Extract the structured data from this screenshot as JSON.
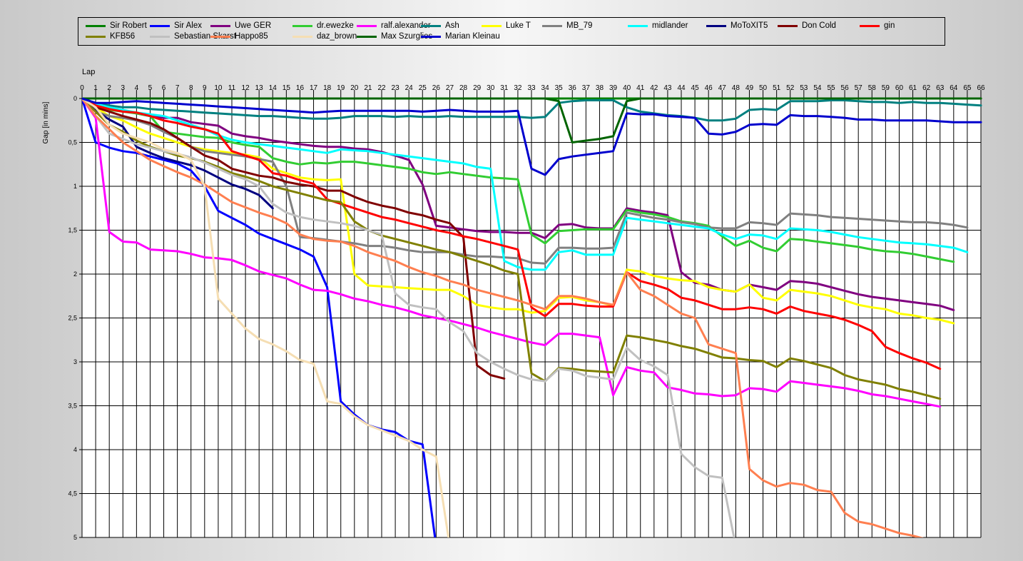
{
  "chart_data": {
    "type": "line",
    "xlabel": "Lap",
    "ylabel": "Gap [in mins]",
    "xlim": [
      0,
      66
    ],
    "ylim": [
      0,
      5
    ],
    "y_ticks": [
      0,
      0.5,
      1,
      1.5,
      2,
      2.5,
      3,
      3.5,
      4,
      4.5,
      5
    ],
    "y_tick_labels": [
      "0",
      "0,5",
      "1",
      "1,5",
      "2",
      "2,5",
      "3",
      "3,5",
      "4",
      "4,5",
      "5"
    ],
    "y_inverted": true,
    "grid": true,
    "legend": "top",
    "series": [
      {
        "name": "Sir Robert",
        "color": "#008000",
        "values": [
          0,
          0,
          0,
          0,
          0,
          0,
          0,
          0,
          0,
          0,
          0,
          0,
          0,
          0,
          0,
          0,
          0,
          0,
          0,
          0,
          0,
          0,
          0,
          0,
          0,
          0,
          0,
          0,
          0,
          0,
          0,
          0,
          0,
          0,
          0,
          0,
          0,
          0,
          0,
          0,
          0,
          0,
          0,
          0,
          0,
          0,
          0,
          0,
          0,
          0,
          0,
          0,
          0,
          0,
          0,
          0,
          0,
          0,
          0,
          0,
          0,
          0,
          0,
          0,
          0,
          0,
          0
        ]
      },
      {
        "name": "Sir Alex",
        "color": "#0000ff",
        "values": [
          0,
          0.5,
          0.56,
          0.6,
          0.62,
          0.66,
          0.7,
          0.74,
          0.82,
          1.0,
          1.28,
          1.36,
          1.44,
          1.54,
          1.6,
          1.66,
          1.72,
          1.8,
          2.15,
          3.45,
          3.6,
          3.72,
          3.77,
          3.8,
          3.9,
          3.94,
          5.1
        ]
      },
      {
        "name": "Uwe GER",
        "color": "#800080",
        "values": [
          0,
          0.1,
          0.12,
          0.14,
          0.17,
          0.2,
          0.22,
          0.22,
          0.27,
          0.29,
          0.31,
          0.4,
          0.43,
          0.45,
          0.48,
          0.5,
          0.52,
          0.54,
          0.55,
          0.55,
          0.57,
          0.58,
          0.61,
          0.65,
          0.7,
          0.98,
          1.45,
          1.47,
          1.49,
          1.51,
          1.52,
          1.52,
          1.53,
          1.53,
          1.59,
          1.44,
          1.43,
          1.47,
          1.48,
          1.48,
          1.25,
          1.28,
          1.3,
          1.33,
          1.98,
          2.1,
          2.12,
          2.18,
          2.2,
          2.12,
          2.15,
          2.18,
          2.08,
          2.09,
          2.11,
          2.15,
          2.19,
          2.23,
          2.26,
          2.28,
          2.3,
          2.32,
          2.34,
          2.36,
          2.41
        ]
      },
      {
        "name": "dr.ewezke",
        "color": "#32cd32",
        "values": [
          0,
          0.1,
          0.13,
          0.15,
          0.17,
          0.2,
          0.38,
          0.4,
          0.42,
          0.44,
          0.45,
          0.5,
          0.53,
          0.55,
          0.68,
          0.72,
          0.75,
          0.73,
          0.74,
          0.72,
          0.72,
          0.74,
          0.76,
          0.78,
          0.8,
          0.84,
          0.86,
          0.84,
          0.86,
          0.88,
          0.9,
          0.91,
          0.92,
          1.55,
          1.65,
          1.51,
          1.5,
          1.49,
          1.49,
          1.49,
          1.27,
          1.3,
          1.32,
          1.35,
          1.4,
          1.42,
          1.45,
          1.57,
          1.68,
          1.62,
          1.7,
          1.74,
          1.6,
          1.61,
          1.63,
          1.65,
          1.67,
          1.69,
          1.72,
          1.74,
          1.75,
          1.77,
          1.8,
          1.83,
          1.86
        ]
      },
      {
        "name": "ralf.alexander",
        "color": "#ff00ff",
        "values": [
          0,
          0.22,
          1.52,
          1.63,
          1.64,
          1.72,
          1.73,
          1.74,
          1.77,
          1.81,
          1.82,
          1.84,
          1.9,
          1.97,
          2.01,
          2.05,
          2.12,
          2.18,
          2.19,
          2.23,
          2.28,
          2.31,
          2.35,
          2.38,
          2.42,
          2.47,
          2.5,
          2.53,
          2.57,
          2.61,
          2.66,
          2.7,
          2.74,
          2.78,
          2.81,
          2.68,
          2.68,
          2.7,
          2.72,
          3.38,
          3.06,
          3.1,
          3.12,
          3.29,
          3.32,
          3.36,
          3.37,
          3.39,
          3.38,
          3.3,
          3.31,
          3.34,
          3.22,
          3.24,
          3.26,
          3.28,
          3.3,
          3.33,
          3.37,
          3.39,
          3.42,
          3.45,
          3.48,
          3.51
        ]
      },
      {
        "name": "Ash",
        "color": "#008080",
        "values": [
          0,
          0.05,
          0.08,
          0.1,
          0.1,
          0.12,
          0.13,
          0.14,
          0.15,
          0.16,
          0.17,
          0.18,
          0.19,
          0.2,
          0.2,
          0.21,
          0.22,
          0.23,
          0.23,
          0.22,
          0.2,
          0.2,
          0.2,
          0.21,
          0.2,
          0.21,
          0.21,
          0.2,
          0.21,
          0.21,
          0.21,
          0.21,
          0.21,
          0.22,
          0.21,
          0.05,
          0.03,
          0.02,
          0.02,
          0.02,
          0.1,
          0.15,
          0.17,
          0.19,
          0.2,
          0.22,
          0.25,
          0.25,
          0.23,
          0.13,
          0.12,
          0.13,
          0.03,
          0.03,
          0.03,
          0.02,
          0.02,
          0.03,
          0.04,
          0.04,
          0.05,
          0.04,
          0.05,
          0.05,
          0.06,
          0.07,
          0.08
        ]
      },
      {
        "name": "Luke T",
        "color": "#ffff00",
        "values": [
          0,
          0.1,
          0.2,
          0.25,
          0.33,
          0.4,
          0.45,
          0.5,
          0.55,
          0.58,
          0.6,
          0.62,
          0.64,
          0.67,
          0.8,
          0.85,
          0.9,
          0.92,
          0.93,
          0.92,
          2.0,
          2.13,
          2.14,
          2.15,
          2.16,
          2.17,
          2.18,
          2.18,
          2.25,
          2.35,
          2.38,
          2.4,
          2.4,
          2.44,
          2.42,
          2.27,
          2.26,
          2.3,
          2.32,
          2.36,
          1.95,
          1.97,
          2.02,
          2.05,
          2.07,
          2.08,
          2.15,
          2.18,
          2.2,
          2.12,
          2.27,
          2.3,
          2.18,
          2.2,
          2.22,
          2.25,
          2.3,
          2.35,
          2.38,
          2.4,
          2.45,
          2.47,
          2.5,
          2.52,
          2.56
        ]
      },
      {
        "name": "MB_79",
        "color": "#808080",
        "values": [
          0,
          0.15,
          0.2,
          0.22,
          0.25,
          0.3,
          0.38,
          0.45,
          0.55,
          0.6,
          0.62,
          0.64,
          0.66,
          0.69,
          0.72,
          1.0,
          1.58,
          1.59,
          1.61,
          1.63,
          1.65,
          1.68,
          1.68,
          1.7,
          1.73,
          1.75,
          1.75,
          1.75,
          1.78,
          1.8,
          1.8,
          1.81,
          1.82,
          1.87,
          1.88,
          1.7,
          1.7,
          1.71,
          1.71,
          1.7,
          1.3,
          1.33,
          1.36,
          1.38,
          1.41,
          1.43,
          1.47,
          1.48,
          1.48,
          1.41,
          1.42,
          1.44,
          1.31,
          1.32,
          1.33,
          1.35,
          1.36,
          1.37,
          1.38,
          1.39,
          1.4,
          1.41,
          1.41,
          1.42,
          1.44,
          1.47
        ]
      },
      {
        "name": "midlander",
        "color": "#00ffff",
        "values": [
          0,
          0.06,
          0.1,
          0.13,
          0.16,
          0.18,
          0.2,
          0.25,
          0.3,
          0.35,
          0.42,
          0.47,
          0.5,
          0.52,
          0.54,
          0.56,
          0.58,
          0.6,
          0.62,
          0.58,
          0.59,
          0.6,
          0.62,
          0.64,
          0.66,
          0.68,
          0.7,
          0.72,
          0.74,
          0.78,
          0.8,
          1.85,
          1.92,
          1.95,
          1.95,
          1.75,
          1.73,
          1.78,
          1.78,
          1.78,
          1.36,
          1.38,
          1.4,
          1.42,
          1.44,
          1.46,
          1.48,
          1.55,
          1.6,
          1.55,
          1.56,
          1.6,
          1.48,
          1.49,
          1.5,
          1.52,
          1.55,
          1.58,
          1.6,
          1.62,
          1.64,
          1.65,
          1.66,
          1.68,
          1.7,
          1.75
        ]
      },
      {
        "name": "MoToXIT5",
        "color": "#000080",
        "values": [
          0,
          0.14,
          0.24,
          0.32,
          0.55,
          0.62,
          0.68,
          0.72,
          0.76,
          0.82,
          0.9,
          0.98,
          1.03,
          1.1,
          1.25
        ]
      },
      {
        "name": "Don Cold",
        "color": "#800000",
        "values": [
          0,
          0.1,
          0.15,
          0.2,
          0.24,
          0.28,
          0.35,
          0.45,
          0.55,
          0.65,
          0.7,
          0.8,
          0.84,
          0.88,
          0.9,
          0.95,
          0.98,
          1.0,
          1.05,
          1.05,
          1.12,
          1.18,
          1.22,
          1.25,
          1.3,
          1.33,
          1.38,
          1.42,
          1.58,
          3.04,
          3.15,
          3.19
        ]
      },
      {
        "name": "gin",
        "color": "#ff0000",
        "values": [
          0,
          0.08,
          0.12,
          0.15,
          0.16,
          0.2,
          0.25,
          0.28,
          0.32,
          0.35,
          0.4,
          0.6,
          0.65,
          0.7,
          0.85,
          0.88,
          0.93,
          0.97,
          1.15,
          1.2,
          1.25,
          1.3,
          1.35,
          1.38,
          1.42,
          1.46,
          1.5,
          1.53,
          1.57,
          1.6,
          1.64,
          1.68,
          1.72,
          2.38,
          2.48,
          2.34,
          2.34,
          2.36,
          2.37,
          2.37,
          1.98,
          2.08,
          2.12,
          2.17,
          2.27,
          2.3,
          2.35,
          2.4,
          2.4,
          2.38,
          2.4,
          2.45,
          2.37,
          2.42,
          2.45,
          2.48,
          2.52,
          2.58,
          2.65,
          2.83,
          2.9,
          2.96,
          3.01,
          3.08
        ]
      },
      {
        "name": "KFB56",
        "color": "#808000",
        "values": [
          0,
          0.15,
          0.3,
          0.38,
          0.48,
          0.55,
          0.6,
          0.65,
          0.68,
          0.72,
          0.78,
          0.85,
          0.89,
          0.94,
          1.0,
          1.04,
          1.08,
          1.12,
          1.16,
          1.18,
          1.4,
          1.5,
          1.56,
          1.6,
          1.64,
          1.68,
          1.72,
          1.75,
          1.8,
          1.85,
          1.9,
          1.96,
          2.0,
          3.13,
          3.22,
          3.07,
          3.08,
          3.1,
          3.11,
          3.12,
          2.7,
          2.72,
          2.75,
          2.78,
          2.82,
          2.85,
          2.9,
          2.95,
          2.96,
          2.98,
          2.99,
          3.06,
          2.96,
          2.99,
          3.03,
          3.07,
          3.15,
          3.2,
          3.23,
          3.26,
          3.31,
          3.34,
          3.38,
          3.42
        ]
      },
      {
        "name": "Sebastian Skarst",
        "color": "#c0c0c0",
        "values": [
          0,
          0.2,
          0.4,
          0.46,
          0.52,
          0.56,
          0.6,
          0.63,
          0.67,
          0.73,
          0.8,
          0.87,
          0.92,
          1.0,
          1.2,
          1.3,
          1.35,
          1.38,
          1.4,
          1.42,
          1.45,
          1.5,
          1.55,
          2.22,
          2.35,
          2.38,
          2.4,
          2.55,
          2.65,
          2.9,
          3.0,
          3.08,
          3.15,
          3.2,
          3.22,
          3.08,
          3.1,
          3.16,
          3.18,
          3.2,
          2.84,
          2.98,
          3.05,
          3.15,
          4.05,
          4.2,
          4.3,
          4.32,
          5.1
        ]
      },
      {
        "name": "Happo85",
        "color": "#ff7f50",
        "values": [
          0,
          0.2,
          0.35,
          0.5,
          0.6,
          0.7,
          0.77,
          0.84,
          0.9,
          0.98,
          1.08,
          1.18,
          1.24,
          1.3,
          1.35,
          1.42,
          1.55,
          1.6,
          1.62,
          1.63,
          1.68,
          1.75,
          1.8,
          1.85,
          1.92,
          1.98,
          2.02,
          2.08,
          2.12,
          2.18,
          2.22,
          2.26,
          2.3,
          2.35,
          2.4,
          2.25,
          2.25,
          2.28,
          2.32,
          2.35,
          1.98,
          2.18,
          2.25,
          2.35,
          2.45,
          2.5,
          2.8,
          2.85,
          2.9,
          4.22,
          4.35,
          4.42,
          4.38,
          4.4,
          4.46,
          4.48,
          4.72,
          4.82,
          4.85,
          4.9,
          4.95,
          4.98,
          5.02
        ]
      },
      {
        "name": "daz_brown",
        "color": "#f5deb3",
        "values": [
          0,
          0.1,
          0.3,
          0.4,
          0.45,
          0.5,
          0.58,
          0.62,
          0.7,
          1.0,
          2.28,
          2.45,
          2.62,
          2.74,
          2.8,
          2.88,
          2.98,
          3.02,
          3.45,
          3.48,
          3.62,
          3.72,
          3.78,
          3.84,
          3.9,
          4.0,
          4.08,
          5.1
        ]
      },
      {
        "name": "Max Szurglies",
        "color": "#006400",
        "values": [
          0,
          0,
          0,
          0,
          0,
          0,
          0,
          0,
          0,
          0,
          0,
          0,
          0,
          0,
          0,
          0,
          0,
          0,
          0,
          0,
          0,
          0,
          0,
          0,
          0,
          0,
          0,
          0,
          0,
          0,
          0,
          0,
          0,
          0,
          0,
          0.03,
          0.5,
          0.48,
          0.46,
          0.43,
          0.03,
          0,
          0,
          0,
          0,
          0,
          0,
          0,
          0,
          0,
          0,
          0,
          0,
          0,
          0,
          0,
          0,
          0,
          0,
          0,
          0,
          0,
          0,
          0,
          0,
          0,
          0
        ]
      },
      {
        "name": "Marian Kleinau",
        "color": "#0000cd",
        "values": [
          0,
          0.05,
          0.05,
          0.04,
          0.03,
          0.04,
          0.05,
          0.06,
          0.07,
          0.08,
          0.09,
          0.1,
          0.11,
          0.12,
          0.13,
          0.14,
          0.15,
          0.16,
          0.15,
          0.14,
          0.14,
          0.14,
          0.14,
          0.14,
          0.14,
          0.15,
          0.14,
          0.13,
          0.14,
          0.15,
          0.15,
          0.15,
          0.14,
          0.8,
          0.87,
          0.69,
          0.66,
          0.64,
          0.62,
          0.6,
          0.17,
          0.18,
          0.18,
          0.2,
          0.21,
          0.22,
          0.4,
          0.41,
          0.38,
          0.3,
          0.29,
          0.3,
          0.19,
          0.2,
          0.2,
          0.21,
          0.22,
          0.24,
          0.24,
          0.25,
          0.25,
          0.25,
          0.25,
          0.26,
          0.27,
          0.27,
          0.27
        ]
      }
    ]
  }
}
